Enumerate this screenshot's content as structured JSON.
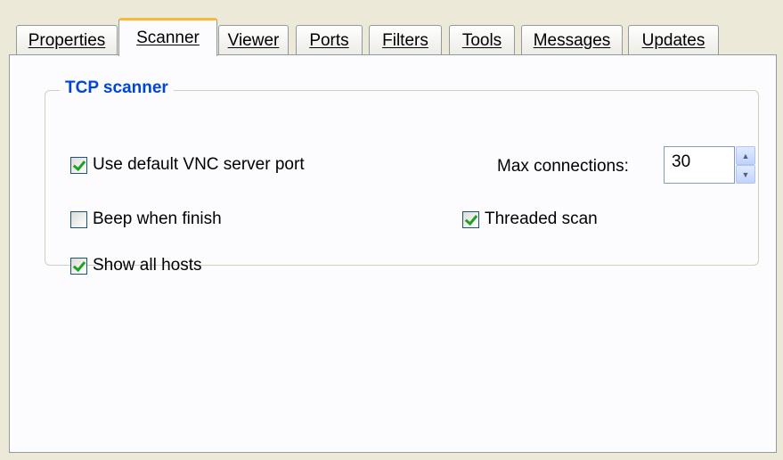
{
  "tabs": [
    {
      "label": "Properties",
      "active": false
    },
    {
      "label": "Scanner",
      "active": true
    },
    {
      "label": "Viewer",
      "active": false
    },
    {
      "label": "Ports",
      "active": false
    },
    {
      "label": "Filters",
      "active": false
    },
    {
      "label": "Tools",
      "active": false
    },
    {
      "label": "Messages",
      "active": false
    },
    {
      "label": "Updates",
      "active": false
    }
  ],
  "group": {
    "title": "TCP scanner",
    "use_default_port": {
      "label": "Use default VNC server port",
      "checked": true
    },
    "beep_when_finish": {
      "label": "Beep when finish",
      "checked": false
    },
    "show_all_hosts": {
      "label": "Show all hosts",
      "checked": true
    },
    "max_connections": {
      "label": "Max connections:",
      "value": "30"
    },
    "threaded_scan": {
      "label": "Threaded scan",
      "checked": true
    }
  },
  "colors": {
    "group_title": "#0046d5",
    "active_tab_accent": "#f9b934",
    "check_mark": "#21a121"
  },
  "icons": {
    "spin_up": "chevron-up-icon",
    "spin_down": "chevron-down-icon"
  }
}
